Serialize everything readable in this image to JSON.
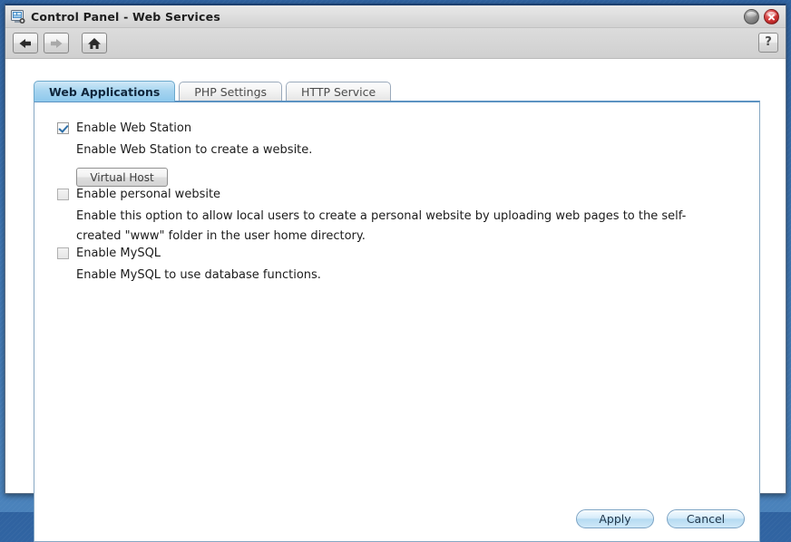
{
  "window": {
    "title": "Control Panel - Web Services",
    "icon": "computer-monitor-icon",
    "minimize_label": "",
    "close_label": ""
  },
  "toolbar": {
    "back_icon": "back-arrow-icon",
    "forward_icon": "forward-arrow-icon",
    "home_icon": "home-icon",
    "help_label": "?"
  },
  "tabs": [
    {
      "label": "Web Applications",
      "active": true
    },
    {
      "label": "PHP Settings",
      "active": false
    },
    {
      "label": "HTTP Service",
      "active": false
    }
  ],
  "options": [
    {
      "label": "Enable Web Station",
      "checked": true,
      "description": "Enable Web Station to create a website.",
      "button": "Virtual Host"
    },
    {
      "label": "Enable personal website",
      "checked": false,
      "description": "Enable this option to allow local users to create a personal website by uploading web pages to the self-created \"www\" folder in the user home directory."
    },
    {
      "label": "Enable MySQL",
      "checked": false,
      "description": "Enable MySQL to use database functions."
    }
  ],
  "footer": {
    "apply_label": "Apply",
    "cancel_label": "Cancel"
  },
  "colors": {
    "desktop": "#3a6ea5",
    "active_tab": "#8ec9ec",
    "panel_border": "#86a7c3",
    "checkmark": "#2d6fa8",
    "close_button": "#d33a3a"
  }
}
